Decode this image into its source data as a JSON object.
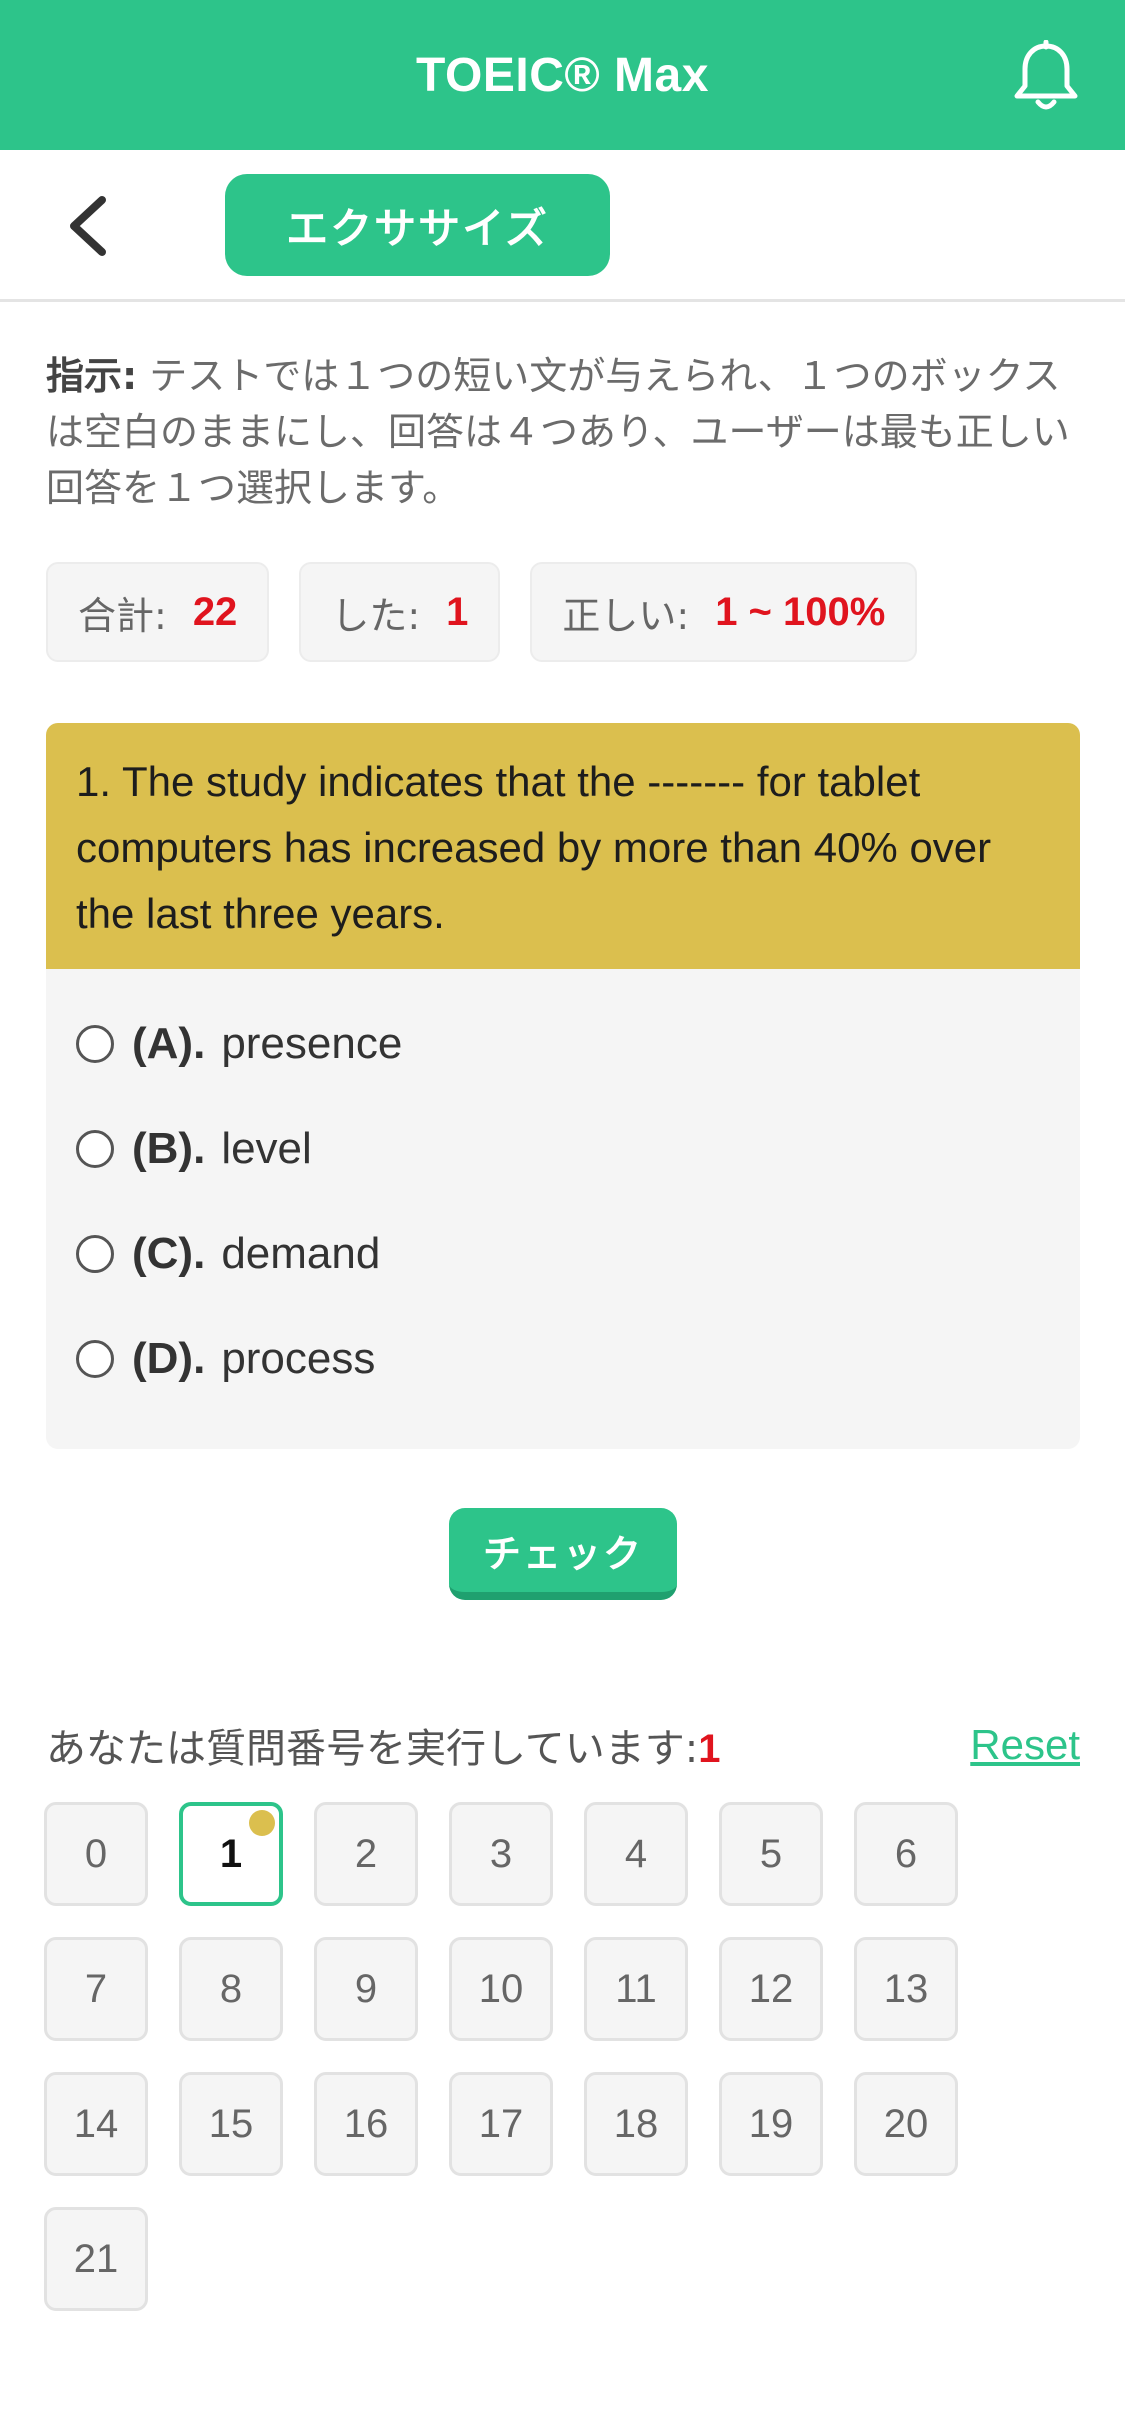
{
  "app": {
    "title": "TOEIC® Max"
  },
  "nav": {
    "section_label": "エクササイズ"
  },
  "instructions": {
    "label": "指示:",
    "text": " テストでは１つの短い文が与えられ、１つのボックスは空白のままにし、回答は４つあり、ユーザーは最も正しい回答を１つ選択します。"
  },
  "stats": {
    "total_label": "合計:",
    "total_value": "22",
    "done_label": "した:",
    "done_value": "1",
    "correct_label": "正しい:",
    "correct_value": "1 ~ 100%"
  },
  "question": {
    "text": "1. The study indicates that the ------- for tablet computers has increased by more than 40% over the last three years.",
    "options": [
      {
        "letter": "(A).",
        "text": "presence"
      },
      {
        "letter": "(B).",
        "text": "level"
      },
      {
        "letter": "(C).",
        "text": "demand"
      },
      {
        "letter": "(D).",
        "text": "process"
      }
    ]
  },
  "check_label": "チェック",
  "progress": {
    "running_label": "あなたは質問番号を実行しています:",
    "current": "1",
    "reset_label": "Reset",
    "numbers": [
      "0",
      "1",
      "2",
      "3",
      "4",
      "5",
      "6",
      "7",
      "8",
      "9",
      "10",
      "11",
      "12",
      "13",
      "14",
      "15",
      "16",
      "17",
      "18",
      "19",
      "20",
      "21"
    ]
  },
  "colors": {
    "accent": "#2dc48a",
    "question_bg": "#dbbf4e",
    "highlight": "#e0141e"
  }
}
